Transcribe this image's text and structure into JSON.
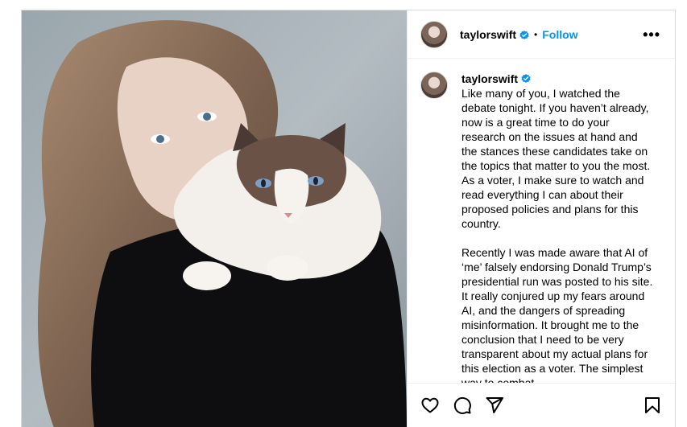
{
  "post": {
    "username": "taylorswift",
    "follow_label": "Follow",
    "separator": "•",
    "more_label": "•••",
    "caption_paragraphs": [
      "Like many of you, I watched the debate tonight. If you haven’t already, now is a great time to do your research on the issues at hand and the stances these candidates take on the topics that matter to you the most. As a voter, I make sure to watch and read everything I can about their proposed policies and plans for this country.",
      "Recently I was made aware that AI of ‘me’ falsely endorsing Donald Trump’s presidential run was posted to his site. It really conjured up my fears around AI, and the dangers of spreading misinformation. It brought me to the conclusion that I need to be very transparent about my actual plans for this election as a voter. The simplest way to combat"
    ]
  },
  "icons": {
    "verified": "verified-badge-icon",
    "like": "heart-icon",
    "comment": "comment-icon",
    "share": "send-icon",
    "save": "bookmark-icon"
  },
  "colors": {
    "accent": "#0095f6",
    "border": "#dbdbdb"
  }
}
